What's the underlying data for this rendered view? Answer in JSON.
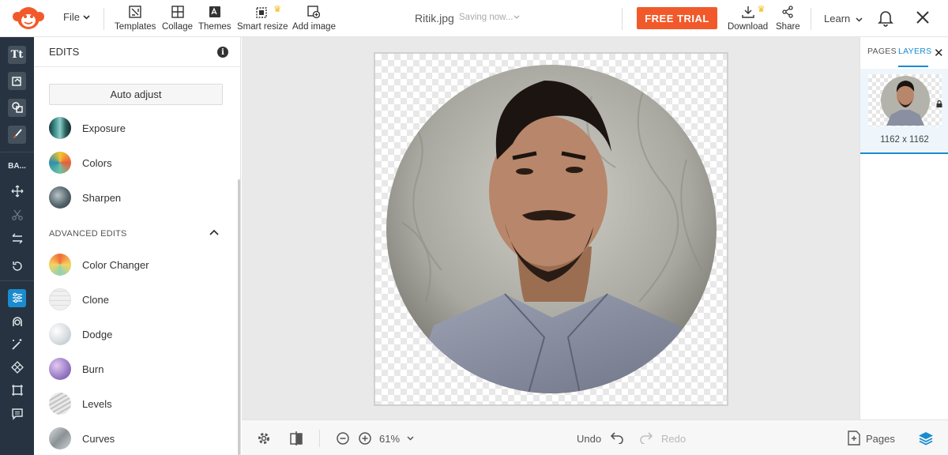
{
  "topbar": {
    "file_label": "File",
    "tools": [
      {
        "label": "Templates",
        "icon": "templates-icon"
      },
      {
        "label": "Collage",
        "icon": "collage-icon"
      },
      {
        "label": "Themes",
        "icon": "themes-icon"
      },
      {
        "label": "Smart resize",
        "icon": "smart-resize-icon",
        "premium": true
      },
      {
        "label": "Add image",
        "icon": "add-image-icon"
      }
    ],
    "filename": "Ritik.jpg",
    "status": "Saving now...",
    "free_trial": "FREE TRIAL",
    "download": "Download",
    "share": "Share",
    "learn": "Learn"
  },
  "rail": {
    "text_item": "BA..."
  },
  "edits_panel": {
    "title": "EDITS",
    "auto_adjust": "Auto adjust",
    "basic": [
      {
        "label": "Exposure"
      },
      {
        "label": "Colors"
      },
      {
        "label": "Sharpen"
      }
    ],
    "advanced_title": "ADVANCED EDITS",
    "advanced": [
      {
        "label": "Color Changer"
      },
      {
        "label": "Clone"
      },
      {
        "label": "Dodge"
      },
      {
        "label": "Burn"
      },
      {
        "label": "Levels"
      },
      {
        "label": "Curves"
      }
    ]
  },
  "bottombar": {
    "zoom": "61%",
    "undo": "Undo",
    "redo": "Redo",
    "pages": "Pages"
  },
  "right_panel": {
    "tab_pages": "PAGES",
    "tab_layers": "LAYERS",
    "layer_dimensions": "1162 x 1162"
  },
  "colors": {
    "accent": "#1a8bcf",
    "free_trial": "#f2592a",
    "rail": "#273340"
  }
}
